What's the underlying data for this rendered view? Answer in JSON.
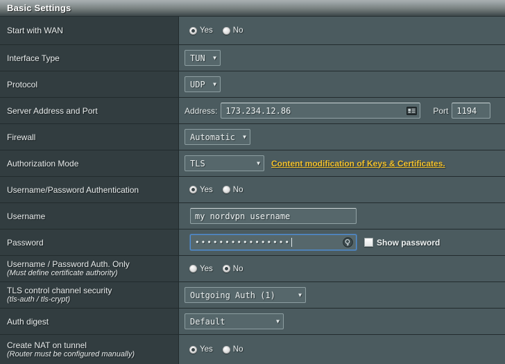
{
  "header": {
    "title": "Basic Settings"
  },
  "colors": {
    "label_column_bg": "#323d40",
    "field_column_bg": "#4b5b5f",
    "row_divider": "#222b2d",
    "link_accent": "#f2c12c",
    "focus_border": "#4f8fd6",
    "text": "#e8ecec"
  },
  "rows": [
    {
      "label": "Start with WAN",
      "sublabel": "",
      "control": "radio",
      "options": [
        "Yes",
        "No"
      ],
      "selected": "Yes"
    },
    {
      "label": "Interface Type",
      "sublabel": "",
      "control": "select",
      "value": "TUN"
    },
    {
      "label": "Protocol",
      "sublabel": "",
      "control": "select",
      "value": "UDP"
    },
    {
      "label": "Server Address and Port",
      "sublabel": "",
      "control": "address-port",
      "address_label": "Address:",
      "address_value": "173.234.12.86",
      "address_icon": "address-card-icon",
      "port_label": "Port",
      "port_value": "1194"
    },
    {
      "label": "Firewall",
      "sublabel": "",
      "control": "select",
      "value": "Automatic"
    },
    {
      "label": "Authorization Mode",
      "sublabel": "",
      "control": "select-link",
      "value": "TLS",
      "link_text": "Content modification of Keys & Certificates."
    },
    {
      "label": "Username/Password Authentication",
      "sublabel": "",
      "control": "radio",
      "options": [
        "Yes",
        "No"
      ],
      "selected": "Yes"
    },
    {
      "label": "Username",
      "sublabel": "",
      "control": "text",
      "value": "my nordvpn username"
    },
    {
      "label": "Password",
      "sublabel": "",
      "control": "password",
      "value": "••••••••••••••••",
      "icon": "key-circle-icon",
      "checkbox_label": "Show password",
      "checkbox_checked": false,
      "focused": true
    },
    {
      "label": "Username / Password Auth. Only",
      "sublabel": "(Must define certificate authority)",
      "control": "radio",
      "options": [
        "Yes",
        "No"
      ],
      "selected": "No"
    },
    {
      "label": "TLS control channel security",
      "sublabel": "(tls-auth / tls-crypt)",
      "control": "select",
      "value": "Outgoing Auth (1)"
    },
    {
      "label": "Auth digest",
      "sublabel": "",
      "control": "select",
      "value": "Default"
    },
    {
      "label": "Create NAT on tunnel",
      "sublabel": "(Router must be configured manually)",
      "control": "radio",
      "options": [
        "Yes",
        "No"
      ],
      "selected": "Yes"
    }
  ]
}
